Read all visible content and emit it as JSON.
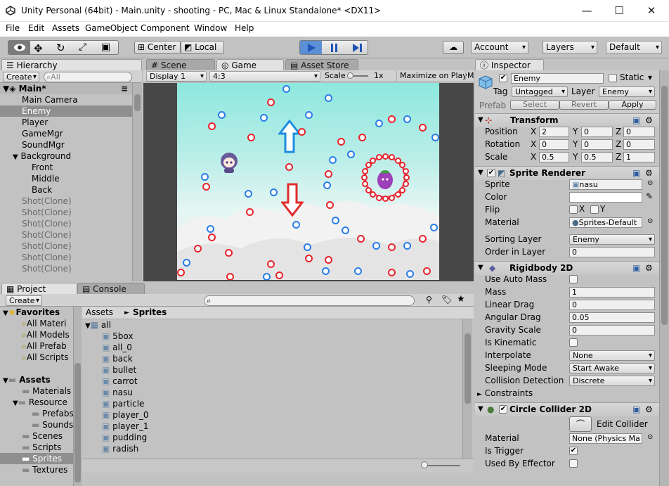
{
  "window": {
    "title": "Unity Personal (64bit) - Main.unity - shooting - PC, Mac & Linux Standalone* <DX11>",
    "minimize": "—",
    "maximize": "☐",
    "close": "✕"
  },
  "menu": [
    "File",
    "Edit",
    "Assets",
    "GameObject",
    "Component",
    "Window",
    "Help"
  ],
  "toolbar": {
    "center": "Center",
    "local": "Local",
    "account": "Account",
    "layers": "Layers",
    "layout": "Default"
  },
  "hierarchy": {
    "tab": "Hierarchy",
    "create": "Create",
    "search_placeholder": "All",
    "scene": "Main*",
    "items": [
      "Main Camera",
      "Enemy",
      "Player",
      "GameMgr",
      "SoundMgr",
      "Background",
      "Front",
      "Middle",
      "Back",
      "Shot(Clone)",
      "Shot(Clone)",
      "Shot(Clone)",
      "Shot(Clone)",
      "Shot(Clone)",
      "Shot(Clone)",
      "Shot(Clone)"
    ]
  },
  "scene_tabs": {
    "scene": "Scene",
    "game": "Game",
    "asset_store": "Asset Store"
  },
  "game_bar": {
    "display": "Display 1",
    "aspect": "4:3",
    "scale_label": "Scale",
    "scale_value": "1x",
    "maximize": "Maximize on Play",
    "more": "M"
  },
  "project": {
    "tab": "Project",
    "console_tab": "Console",
    "create": "Create",
    "favorites": {
      "label": "Favorites",
      "items": [
        "All Materi",
        "All Models",
        "All Prefab",
        "All Scripts"
      ]
    },
    "assets": {
      "label": "Assets",
      "items": [
        "Materials",
        "Resource",
        "Prefabs",
        "Sounds",
        "Scenes",
        "Scripts",
        "Sprites",
        "Textures"
      ]
    },
    "breadcrumb": [
      "Assets",
      "Sprites"
    ],
    "files": [
      "all",
      "5box",
      "all_0",
      "back",
      "bullet",
      "carrot",
      "nasu",
      "particle",
      "player_0",
      "player_1",
      "pudding",
      "radish"
    ]
  },
  "inspector": {
    "tab": "Inspector",
    "name": "Enemy",
    "static": "Static",
    "tag_label": "Tag",
    "tag": "Untagged",
    "layer_label": "Layer",
    "layer": "Enemy",
    "prefab_label": "Prefab",
    "select": "Select",
    "revert": "Revert",
    "apply": "Apply",
    "transform": {
      "title": "Transform",
      "position": {
        "label": "Position",
        "x": "2",
        "y": "0",
        "z": "0"
      },
      "rotation": {
        "label": "Rotation",
        "x": "0",
        "y": "0",
        "z": "0"
      },
      "scale": {
        "label": "Scale",
        "x": "0.5",
        "y": "0.5",
        "z": "1"
      }
    },
    "sprite_renderer": {
      "title": "Sprite Renderer",
      "sprite_label": "Sprite",
      "sprite": "nasu",
      "color_label": "Color",
      "flip_label": "Flip",
      "flip_x": "X",
      "flip_y": "Y",
      "material_label": "Material",
      "material": "Sprites-Default",
      "sorting_layer_label": "Sorting Layer",
      "sorting_layer": "Enemy",
      "order_label": "Order in Layer",
      "order": "0"
    },
    "rigidbody": {
      "title": "Rigidbody 2D",
      "use_auto_mass": "Use Auto Mass",
      "mass_label": "Mass",
      "mass": "1",
      "linear_drag_label": "Linear Drag",
      "linear_drag": "0",
      "angular_drag_label": "Angular Drag",
      "angular_drag": "0.05",
      "gravity_label": "Gravity Scale",
      "gravity": "0",
      "kinematic_label": "Is Kinematic",
      "interpolate_label": "Interpolate",
      "interpolate": "None",
      "sleeping_label": "Sleeping Mode",
      "sleeping": "Start Awake",
      "collision_label": "Collision Detection",
      "collision": "Discrete",
      "constraints_label": "Constraints"
    },
    "circle_collider": {
      "title": "Circle Collider 2D",
      "edit_collider": "Edit Collider",
      "material_label": "Material",
      "material": "None (Physics Ma",
      "trigger_label": "Is Trigger",
      "effector_label": "Used By Effector"
    }
  },
  "colors": {
    "accent": "#3d7fe0",
    "selection": "#8f8f8f",
    "play_active": "#5b8fd6"
  }
}
